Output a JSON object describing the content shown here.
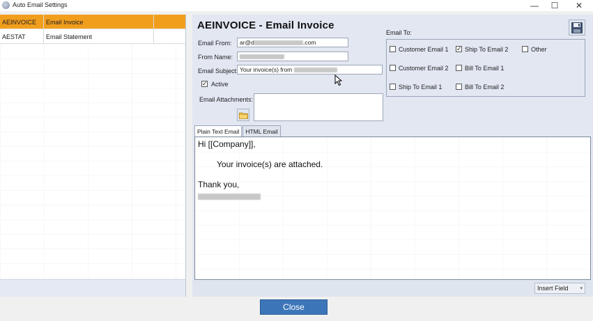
{
  "window": {
    "title": "Auto Email Settings",
    "minimize_glyph": "—",
    "maximize_glyph": "☐",
    "close_glyph": "✕"
  },
  "left_list": {
    "rows": [
      {
        "code": "AEINVOICE",
        "name": "Email Invoice",
        "selected": true
      },
      {
        "code": "AESTAT",
        "name": "Email Statement",
        "selected": false
      }
    ]
  },
  "header": {
    "title": "AEINVOICE  - Email Invoice"
  },
  "form": {
    "email_from_label": "Email From:",
    "email_from_prefix": "ar@d",
    "email_from_suffix": ".com",
    "from_name_label": "From Name:",
    "email_subject_label": "Email Subject:",
    "email_subject_prefix": "Your invoice(s) from ",
    "active_label": "Active",
    "active_checked": true,
    "attachments_label": "Email Attachments:"
  },
  "email_to": {
    "label": "Email To:",
    "options": [
      {
        "label": "Customer Email 1",
        "checked": false
      },
      {
        "label": "Ship To Email 2",
        "checked": true
      },
      {
        "label": "Other",
        "checked": false
      },
      {
        "label": "Customer Email 2",
        "checked": false
      },
      {
        "label": "Bill To Email 1",
        "checked": false
      },
      {
        "label": "Ship To Email 1",
        "checked": false
      },
      {
        "label": "Bill To Email 2",
        "checked": false
      }
    ]
  },
  "tabs": [
    {
      "label": "Plain Text Email",
      "active": true
    },
    {
      "label": "HTML Email",
      "active": false
    }
  ],
  "editor": {
    "line1": "Hi [[Company]],",
    "line2": "Your invoice(s) are attached.",
    "line3": "Thank you,"
  },
  "insert_field": {
    "label": "Insert Field"
  },
  "buttons": {
    "close_label": "Close"
  },
  "icons": {
    "app": "app-icon",
    "save": "floppy-disk-icon",
    "folder": "folder-icon"
  }
}
